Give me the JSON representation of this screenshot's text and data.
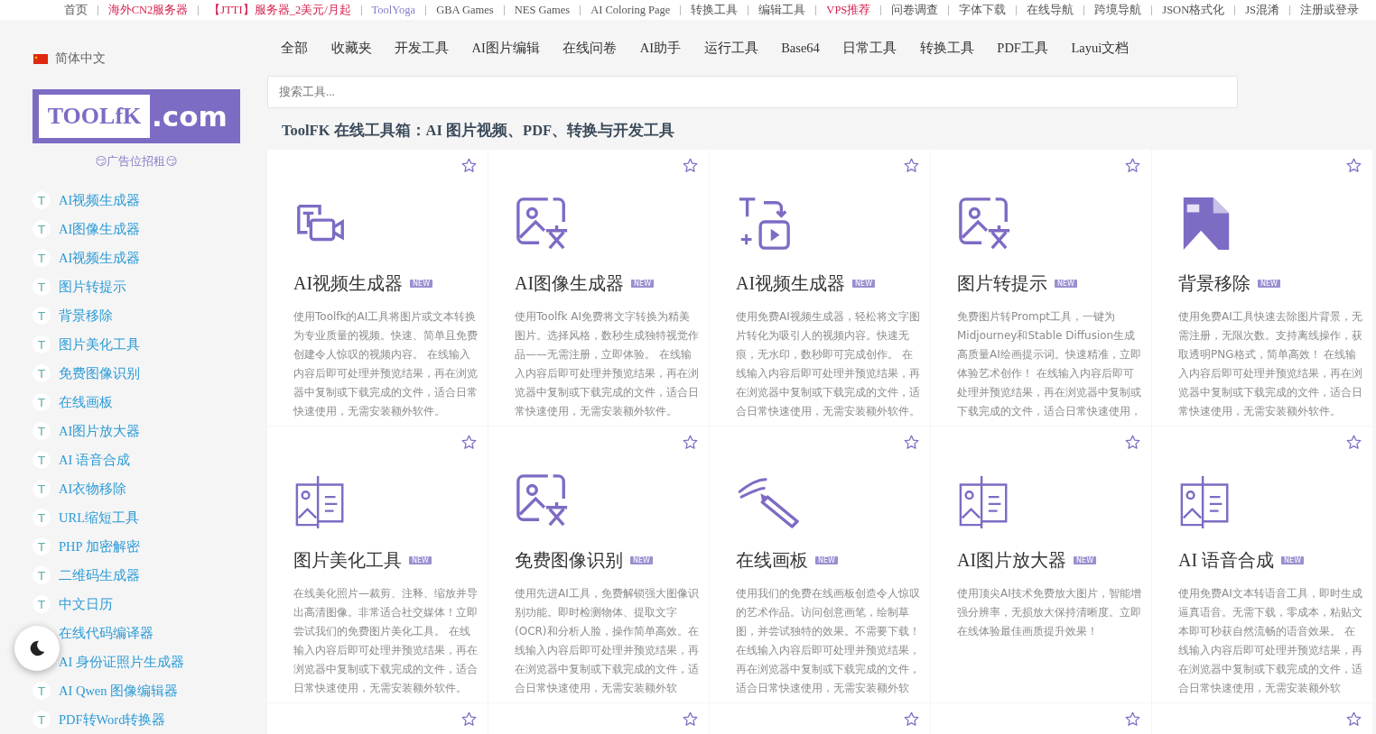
{
  "top_links": [
    {
      "label": "首页",
      "color": "#555555"
    },
    {
      "label": "海外CN2服务器",
      "color": "#d6204e"
    },
    {
      "label": "【JTTI】服务器_2美元/月起",
      "color": "#d6204e"
    },
    {
      "label": "ToolYoga",
      "color": "#7f7fc9"
    },
    {
      "label": "GBA Games",
      "color": "#555555"
    },
    {
      "label": "NES Games",
      "color": "#555555"
    },
    {
      "label": "AI Coloring Page",
      "color": "#555555"
    },
    {
      "label": "转换工具",
      "color": "#555555"
    },
    {
      "label": "编辑工具",
      "color": "#555555"
    },
    {
      "label": "VPS推荐",
      "color": "#d6204e"
    },
    {
      "label": "问卷调查",
      "color": "#555555"
    },
    {
      "label": "字体下载",
      "color": "#555555"
    },
    {
      "label": "在线导航",
      "color": "#555555"
    },
    {
      "label": "跨境导航",
      "color": "#555555"
    },
    {
      "label": "JSON格式化",
      "color": "#555555"
    },
    {
      "label": "JS混淆",
      "color": "#555555"
    },
    {
      "label": "注册或登录",
      "color": "#555555"
    }
  ],
  "sidebar": {
    "language": "简体中文",
    "logo": {
      "left": "TOOLfK",
      "right": ".com"
    },
    "ad": "😏广告位招租😏",
    "items": [
      {
        "icon": "T",
        "label": "AI视频生成器"
      },
      {
        "icon": "T",
        "label": "AI图像生成器"
      },
      {
        "icon": "T",
        "label": "AI视频生成器"
      },
      {
        "icon": "T",
        "label": "图片转提示"
      },
      {
        "icon": "T",
        "label": "背景移除"
      },
      {
        "icon": "T",
        "label": "图片美化工具"
      },
      {
        "icon": "T",
        "label": "免费图像识别"
      },
      {
        "icon": "T",
        "label": "在线画板"
      },
      {
        "icon": "T",
        "label": "AI图片放大器"
      },
      {
        "icon": "T",
        "label": "AI 语音合成"
      },
      {
        "icon": "T",
        "label": "AI衣物移除"
      },
      {
        "icon": "T",
        "label": "URL缩短工具"
      },
      {
        "icon": "T",
        "label": "PHP 加密解密"
      },
      {
        "icon": "T",
        "label": "二维码生成器"
      },
      {
        "icon": "T",
        "label": "中文日历"
      },
      {
        "label": "在线代码编译器"
      },
      {
        "label": "AI 身份证照片生成器"
      },
      {
        "icon": "T",
        "label": "AI Qwen 图像编辑器"
      },
      {
        "icon": "T",
        "label": "PDF转Word转换器"
      }
    ]
  },
  "tabs": [
    "全部",
    "收藏夹",
    "开发工具",
    "AI图片编辑",
    "在线问卷",
    "AI助手",
    "运行工具",
    "Base64",
    "日常工具",
    "转换工具",
    "PDF工具",
    "Layui文档"
  ],
  "search": {
    "placeholder": "搜索工具..."
  },
  "heading": "ToolFK 在线工具箱：AI 图片视频、PDF、转换与开发工具",
  "cards": [
    {
      "kind": "video",
      "title": "AI视频生成器",
      "badge": "NEW",
      "description": "使用Toolfk的AI工具将图片或文本转换为专业质量的视频。快速、简单且免费创建令人惊叹的视频内容。 在线输入内容后即可处理并预览结果，再在浏览器中复制或下载完成的文件，适合日常快速使用，无需安装额外软件。"
    },
    {
      "kind": "image",
      "title": "AI图像生成器",
      "badge": "NEW",
      "description": "使用Toolfk AI免费将文字转换为精美图片。选择风格，数秒生成独特视觉作品——无需注册，立即体验。 在线输入内容后即可处理并预览结果，再在浏览器中复制或下载完成的文件，适合日常快速使用，无需安装额外软件。"
    },
    {
      "kind": "convert",
      "title": "AI视频生成器",
      "badge": "NEW",
      "description": "使用免费AI视频生成器，轻松将文字图片转化为吸引人的视频内容。快速无痕，无水印，数秒即可完成创作。 在线输入内容后即可处理并预览结果，再在浏览器中复制或下载完成的文件，适合日常快速使用，无需安装额外软件。"
    },
    {
      "kind": "image",
      "title": "图片转提示",
      "badge": "NEW",
      "description": "免费图片转Prompt工具，一键为Midjourney和Stable Diffusion生成高质量AI绘画提示词。快速精准，立即体验艺术创作！ 在线输入内容后即可处理并预览结果，再在浏览器中复制或下载完成的文件，适合日常快速使用，"
    },
    {
      "kind": "document",
      "title": "背景移除",
      "badge": "NEW",
      "description": "使用免费AI工具快速去除图片背景，无需注册，无限次数。支持离线操作，获取透明PNG格式，简单高效！ 在线输入内容后即可处理并预览结果，再在浏览器中复制或下载完成的文件，适合日常快速使用，无需安装额外软件。"
    },
    {
      "kind": "board",
      "title": "图片美化工具",
      "badge": "NEW",
      "description": "在线美化照片—裁剪、注释、缩放并导出高清图像。非常适合社交媒体！立即尝试我们的免费图片美化工具。 在线输入内容后即可处理并预览结果，再在浏览器中复制或下载完成的文件，适合日常快速使用，无需安装额外软件。"
    },
    {
      "kind": "image",
      "title": "免费图像识别",
      "badge": "NEW",
      "description": "使用先进AI工具，免费解锁强大图像识别功能。即时检测物体、提取文字(OCR)和分析人脸，操作简单高效。在线输入内容后即可处理并预览结果，再在浏览器中复制或下载完成的文件，适合日常快速使用，无需安装额外软"
    },
    {
      "kind": "pencil",
      "title": "在线画板",
      "badge": "NEW",
      "description": "使用我们的免费在线画板创造令人惊叹的艺术作品。访问创意画笔，绘制草图，并尝试独特的效果。不需要下载！在线输入内容后即可处理并预览结果，再在浏览器中复制或下载完成的文件，适合日常快速使用，无需安装额外软"
    },
    {
      "kind": "board",
      "title": "AI图片放大器",
      "badge": "NEW",
      "description": "使用顶尖AI技术免费放大图片，智能增强分辨率，无损放大保持清晰度。立即在线体验最佳画质提升效果！"
    },
    {
      "kind": "board",
      "title": "AI 语音合成",
      "badge": "NEW",
      "description": "使用免费AI文本转语音工具，即时生成逼真语音。无需下载，零成本，粘贴文本即可秒获自然流畅的语音效果。 在线输入内容后即可处理并预览结果，再在浏览器中复制或下载完成的文件，适合日常快速使用，无需安装额外软"
    },
    {
      "kind": "partial"
    },
    {
      "kind": "partial"
    },
    {
      "kind": "partial"
    },
    {
      "kind": "partial"
    },
    {
      "kind": "partial"
    }
  ]
}
